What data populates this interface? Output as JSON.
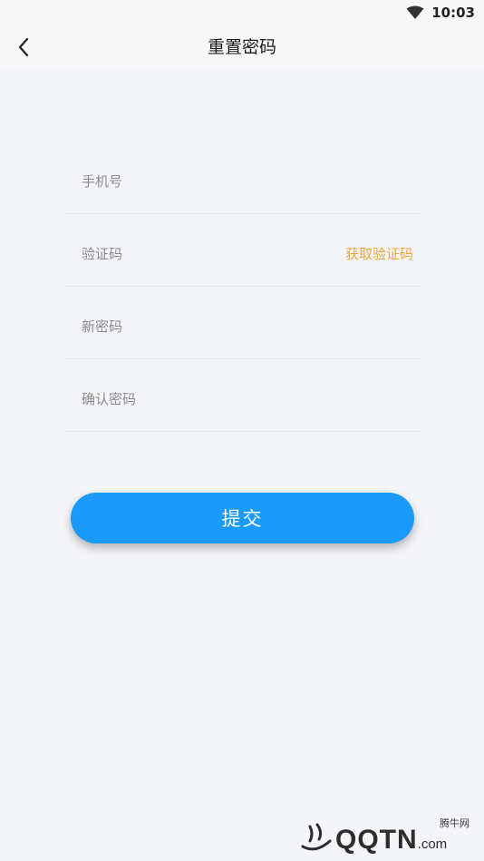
{
  "status": {
    "time": "10:03"
  },
  "nav": {
    "title": "重置密码"
  },
  "form": {
    "phone_placeholder": "手机号",
    "code_placeholder": "验证码",
    "get_code_label": "获取验证码",
    "new_password_placeholder": "新密码",
    "confirm_password_placeholder": "确认密码"
  },
  "submit_label": "提交",
  "watermark": {
    "small": "腾牛网",
    "brand": "QQTN",
    "suffix": ".com"
  },
  "colors": {
    "accent": "#1a9bfb",
    "link": "#f2a23a",
    "background": "#f4f5f8"
  },
  "icons": {
    "back": "back-arrow-icon",
    "wifi": "wifi-icon"
  }
}
